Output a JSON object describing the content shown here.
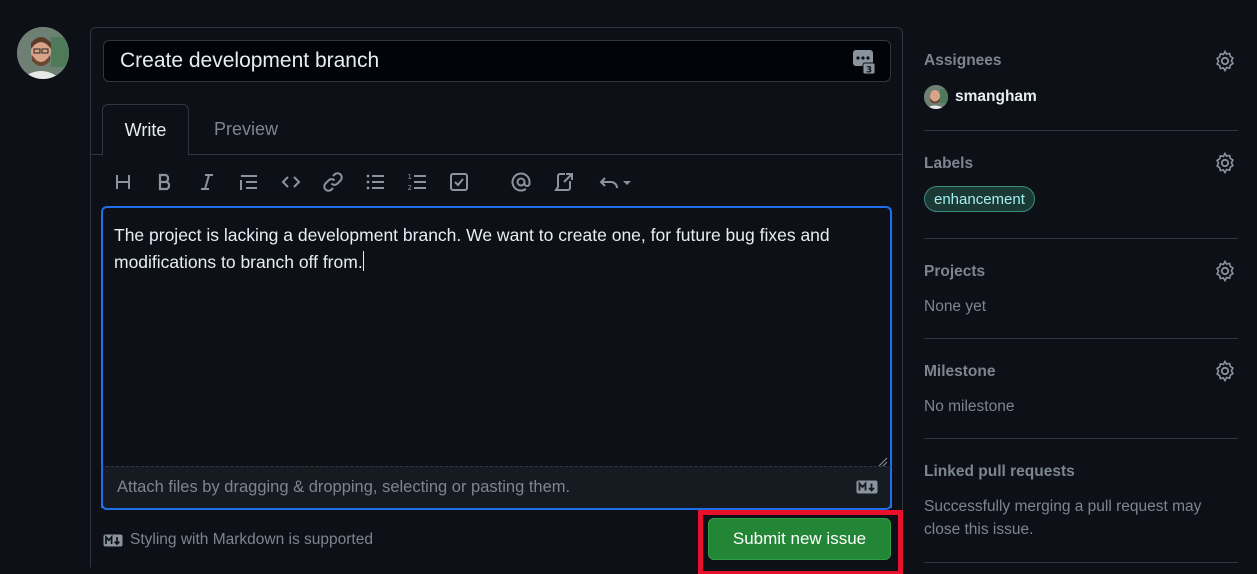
{
  "issue": {
    "title": "Create development branch",
    "body_line1": "The project is lacking a development branch. We want to create one, for future bug fixes and",
    "body_line2": "modifications to branch off from.",
    "attach_hint": "Attach files by dragging & dropping, selecting or pasting them.",
    "markdown_note": "Styling with Markdown is supported",
    "submit_label": "Submit new issue"
  },
  "tabs": [
    {
      "label": "Write",
      "active": true
    },
    {
      "label": "Preview",
      "active": false
    }
  ],
  "toolbar": {
    "icons": [
      "heading-icon",
      "bold-icon",
      "italic-icon",
      "quote-icon",
      "code-icon",
      "link-icon",
      "bulleted-list-icon",
      "numbered-list-icon",
      "task-list-icon",
      "mention-icon",
      "reference-icon",
      "undo-icon"
    ]
  },
  "sidebar": {
    "assignees": {
      "heading": "Assignees",
      "user": "smangham"
    },
    "labels": {
      "heading": "Labels",
      "label": "enhancement"
    },
    "projects": {
      "heading": "Projects",
      "value": "None yet"
    },
    "milestone": {
      "heading": "Milestone",
      "value": "No milestone"
    },
    "linked": {
      "heading": "Linked pull requests",
      "value_line1": "Successfully merging a pull request may",
      "value_line2": "close this issue."
    }
  },
  "colors": {
    "background": "#0d1117",
    "border": "#30363d",
    "focus": "#1f6feb",
    "submit": "#238636",
    "highlight_outline": "#e8102a",
    "label_text": "#a2eeef"
  }
}
